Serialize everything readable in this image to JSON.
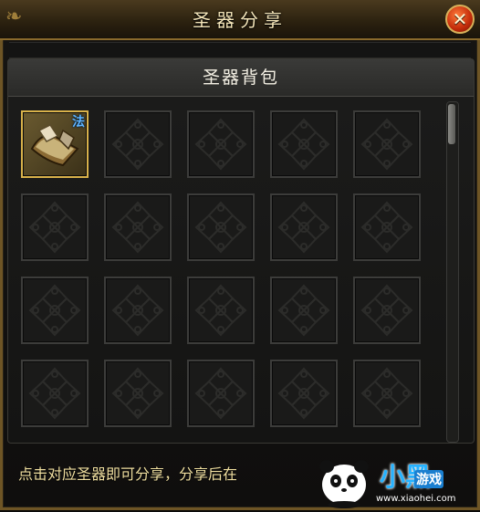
{
  "window": {
    "title": "圣器分享",
    "close_label": "✕"
  },
  "bag": {
    "title": "圣器背包",
    "slots": [
      {
        "filled": true,
        "badge": "法"
      },
      {
        "filled": false
      },
      {
        "filled": false
      },
      {
        "filled": false
      },
      {
        "filled": false
      },
      {
        "filled": false
      },
      {
        "filled": false
      },
      {
        "filled": false
      },
      {
        "filled": false
      },
      {
        "filled": false
      },
      {
        "filled": false
      },
      {
        "filled": false
      },
      {
        "filled": false
      },
      {
        "filled": false
      },
      {
        "filled": false
      },
      {
        "filled": false
      },
      {
        "filled": false
      },
      {
        "filled": false
      },
      {
        "filled": false
      },
      {
        "filled": false
      }
    ],
    "scroll_position": 0.0
  },
  "footer": {
    "hint": "点击对应圣器即可分享，分享后在"
  },
  "watermark": {
    "brand": "小黑",
    "brand_sub": "游戏",
    "url": "www.xiaohei.com"
  },
  "colors": {
    "gold_border": "#d9b24a",
    "badge_blue": "#5fb4ff",
    "close_red": "#c22b0a"
  },
  "icons": {
    "item": "book-icon",
    "close": "close-icon",
    "slot_emblem": "diamond-knot-emblem"
  }
}
